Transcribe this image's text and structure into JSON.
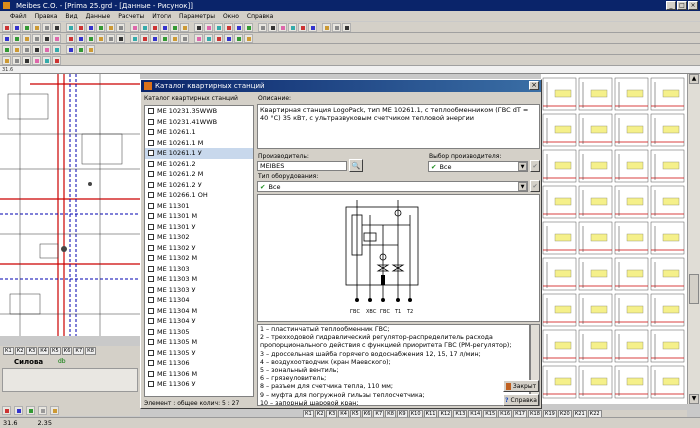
{
  "window": {
    "title": "Meibes C.O. - [Prima 25.grd - [Данные - Рисунок]]"
  },
  "menu": [
    "Файл",
    "Правка",
    "Вид",
    "Данные",
    "Расчеты",
    "Итоги",
    "Параметры",
    "Окно",
    "Справка"
  ],
  "ruler": {
    "left_value": "31.6"
  },
  "left_panel": {
    "tabs": [
      "К1",
      "К2",
      "К3",
      "К4",
      "К5",
      "К6",
      "К7",
      "К8",
      "К9",
      "К10"
    ],
    "tab_title": "Силова",
    "tab_title2": "db"
  },
  "dialog": {
    "title": "Каталог квартирных станций",
    "list_label": "Каталог квартирных станций",
    "items": [
      "ME 10231.35WWB",
      "ME 10231.41WWB",
      "ME 10261.1",
      "ME 10261.1 M",
      "ME 10261.1 У",
      "ME 10261.2",
      "ME 10261.2 M",
      "ME 10261.2 У",
      "ME 10266.1 ОН",
      "ME 11301",
      "ME 11301 M",
      "ME 11301 У",
      "ME 11302",
      "ME 11302 У",
      "ME 11302 M",
      "ME 11303",
      "ME 11303 M",
      "ME 11303 У",
      "ME 11304",
      "ME 11304 M",
      "ME 11304 У",
      "ME 11305",
      "ME 11305 M",
      "ME 11305 У",
      "ME 11306",
      "ME 11306 M",
      "ME 11306 У"
    ],
    "selected_index": 4,
    "desc_label": "Описание:",
    "description": "Квартирная станция LogoPack, тип ME 10261.1, с теплообменником (ГВС dT = 40 °C) 35 кВт, с ультразвуковым счетчиком тепловой энергии",
    "manufacturer_label": "Производитель:",
    "manufacturer_value": "MEIBES",
    "choose_manufacturer_label": "Выбор производителя:",
    "choose_manufacturer_value": "Все",
    "equipment_type_label": "Тип оборудования:",
    "equipment_type_value": "Все",
    "legend": [
      "1 – пластинчатый теплообменник ГВС;",
      "2 – трехходовой гидравлический регулятор-распределитель расхода пропорционального действия с функцией приоритета ГВС (PM-регулятор);",
      "3 – дроссельная шайба горячего водоснабжения 12, 15, 17 л/мин;",
      "4 – воздухоотводчик (кран Маевского);",
      "5 – зональный вентиль;",
      "6 – грязеуловитель;",
      "8 – разъем для счетчика тепла, 110 мм;",
      "9 – муфта для погружной гильзы теплосчетчика;",
      "10 – запорный шаровой кран;"
    ],
    "footer": "Элемент : общее колич: 5 : 27",
    "close_label": "Закрыт",
    "help_label": "Справка",
    "diagram_labels": [
      "ГВС",
      "ХВС",
      "ГВС",
      "T1",
      "T2"
    ]
  },
  "status": {
    "coords": "31.6",
    "value": "2.35"
  },
  "right_tabs": [
    "К1",
    "К2",
    "К3",
    "К4",
    "К5",
    "К6",
    "К7",
    "К8",
    "К9",
    "К10",
    "К11",
    "К12",
    "К13",
    "К14",
    "К15",
    "К16",
    "К17",
    "К18",
    "К19",
    "К20",
    "К21",
    "К22"
  ]
}
